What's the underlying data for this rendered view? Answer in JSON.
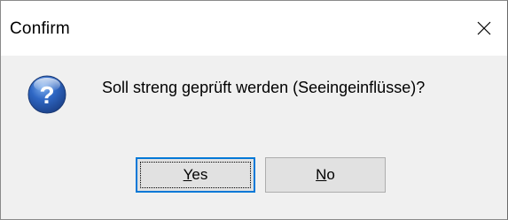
{
  "window": {
    "title": "Confirm",
    "close_icon": "close-icon"
  },
  "dialog": {
    "icon": "question-icon",
    "message": "Soll streng geprüft werden (Seeingeinflüsse)?"
  },
  "buttons": {
    "yes": {
      "mnemonic": "Y",
      "rest": "es"
    },
    "no": {
      "mnemonic": "N",
      "rest": "o"
    }
  },
  "colors": {
    "focus_border": "#0078d7",
    "button_face": "#e1e1e1",
    "dialog_body": "#f0f0f0",
    "icon_blue": "#2a5db0"
  }
}
